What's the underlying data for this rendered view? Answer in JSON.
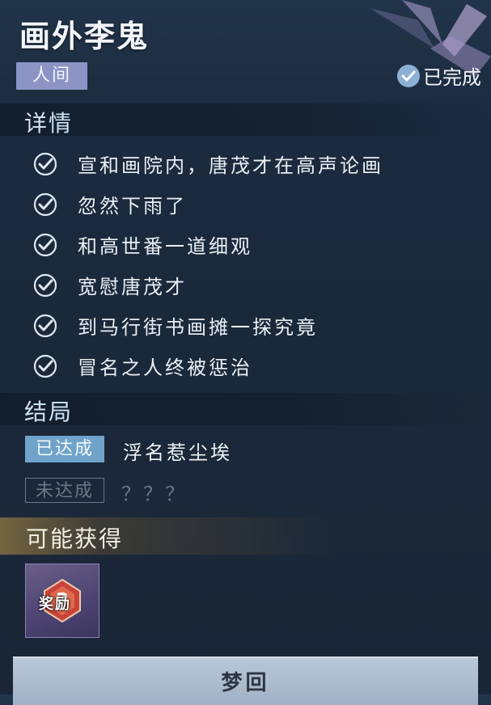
{
  "quest": {
    "title": "画外李鬼",
    "realm": "人间",
    "status": "已完成"
  },
  "details": {
    "heading": "详情",
    "items": [
      "宣和画院内，唐茂才在高声论画",
      "忽然下雨了",
      "和高世番一道细观",
      "宽慰唐茂才",
      "到马行街书画摊一探究竟",
      "冒名之人终被惩治"
    ]
  },
  "endings": {
    "heading": "结局",
    "achieved": {
      "badge": "已达成",
      "text": "浮名惹尘埃"
    },
    "unachieved": {
      "badge": "未达成",
      "text": "？？？"
    }
  },
  "rewards": {
    "heading": "可能获得",
    "item_label": "奖励",
    "item_icon": "question-mark-icon"
  },
  "action": {
    "label": "梦回"
  },
  "colors": {
    "accent_blue": "#6fa3c9",
    "realm_tag": "#8b94c4",
    "reward_gold": "#be9646"
  }
}
